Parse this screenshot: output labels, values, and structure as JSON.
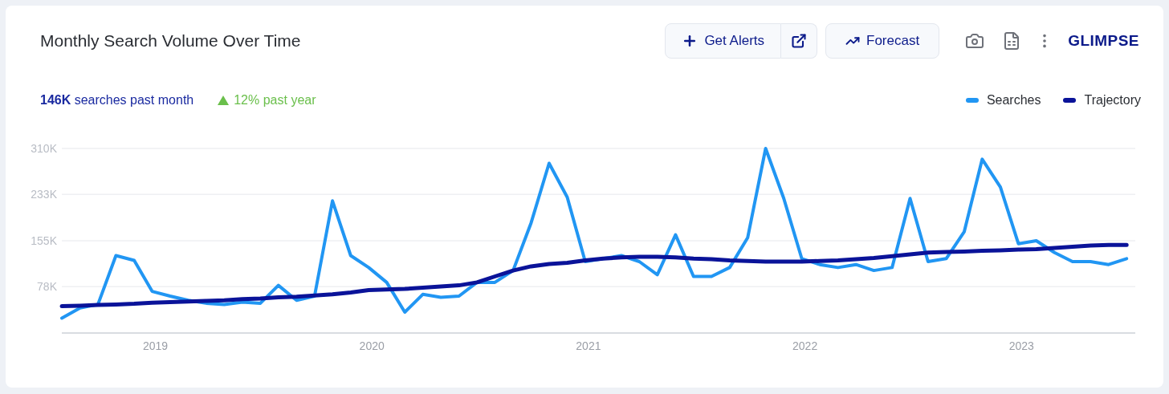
{
  "card": {
    "title": "Monthly Search Volume Over Time",
    "actions": [
      {
        "kind": "alerts",
        "label": "Get Alerts"
      },
      {
        "kind": "external"
      },
      {
        "kind": "forecast",
        "label": "Forecast"
      }
    ],
    "logo": "GLIMPSE",
    "stats": [
      {
        "kind": "volume",
        "text": "**146K** searches past month"
      },
      {
        "kind": "growth",
        "text": "12% past year"
      }
    ],
    "chart_data": {
      "type": "line",
      "x": [
        2018.583,
        2018.667,
        2018.75,
        2018.833,
        2018.917,
        2019,
        2019.083,
        2019.167,
        2019.25,
        2019.333,
        2019.417,
        2019.5,
        2019.583,
        2019.667,
        2019.75,
        2019.833,
        2019.917,
        2020,
        2020.083,
        2020.167,
        2020.25,
        2020.333,
        2020.417,
        2020.5,
        2020.583,
        2020.667,
        2020.75,
        2020.833,
        2020.917,
        2021,
        2021.083,
        2021.167,
        2021.25,
        2021.333,
        2021.417,
        2021.5,
        2021.583,
        2021.667,
        2021.75,
        2021.833,
        2021.917,
        2022,
        2022.083,
        2022.167,
        2022.25,
        2022.333,
        2022.417,
        2022.5,
        2022.583,
        2022.667,
        2022.75,
        2022.833,
        2022.917,
        2023,
        2023.083,
        2023.167,
        2023.25,
        2023.333,
        2023.417,
        2023.5
      ],
      "xlim": [
        2018.583,
        2023.54
      ],
      "ylim": [
        0,
        310000
      ],
      "grid": true,
      "xticks": [
        2019,
        2020,
        2021,
        2022,
        2023
      ],
      "yticks": [
        {
          "value": 78000,
          "label": "78K"
        },
        {
          "value": 155000,
          "label": "155K"
        },
        {
          "value": 233000,
          "label": "233K"
        },
        {
          "value": 310000,
          "label": "310K"
        }
      ],
      "series": [
        {
          "name": "Searches",
          "color": "#2196f3",
          "values": [
            25000,
            42000,
            48000,
            130000,
            122000,
            70000,
            62000,
            55000,
            50000,
            48000,
            52000,
            50000,
            80000,
            55000,
            62000,
            222000,
            130000,
            110000,
            85000,
            35000,
            65000,
            60000,
            62000,
            85000,
            85000,
            105000,
            185000,
            285000,
            228000,
            120000,
            125000,
            130000,
            120000,
            98000,
            165000,
            95000,
            95000,
            110000,
            160000,
            310000,
            226000,
            125000,
            115000,
            110000,
            115000,
            105000,
            110000,
            226000,
            120000,
            125000,
            170000,
            292000,
            245000,
            150000,
            155000,
            135000,
            120000,
            120000,
            115000,
            125000
          ]
        },
        {
          "name": "Trajectory",
          "color": "#0a1399",
          "values": [
            45000,
            46000,
            47000,
            48000,
            49000,
            51000,
            52000,
            53000,
            54000,
            55000,
            57000,
            58000,
            60000,
            61000,
            63000,
            65000,
            68000,
            72000,
            73000,
            74000,
            76000,
            78000,
            80000,
            85000,
            95000,
            105000,
            112000,
            116000,
            118000,
            122000,
            125000,
            127000,
            128000,
            128000,
            127000,
            125000,
            124000,
            122000,
            121000,
            120000,
            120000,
            120000,
            121000,
            122000,
            124000,
            126000,
            129000,
            132000,
            135000,
            136000,
            137000,
            138000,
            139000,
            140000,
            141000,
            143000,
            145000,
            147000,
            148000,
            148000
          ]
        }
      ]
    }
  }
}
